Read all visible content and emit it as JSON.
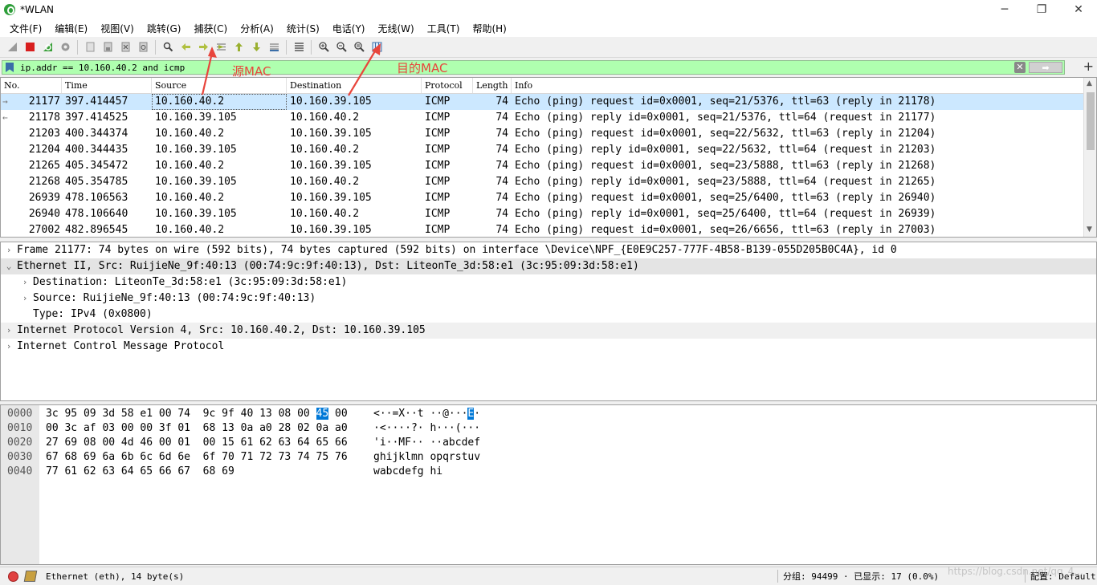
{
  "window": {
    "title": "*WLAN",
    "minimize": "─",
    "maximize": "❐",
    "close": "✕"
  },
  "menu": [
    "文件(F)",
    "编辑(E)",
    "视图(V)",
    "跳转(G)",
    "捕获(C)",
    "分析(A)",
    "统计(S)",
    "电话(Y)",
    "无线(W)",
    "工具(T)",
    "帮助(H)"
  ],
  "filter": {
    "value": "ip.addr == 10.160.40.2 and icmp",
    "clear_icon": "✕",
    "apply_icon": "➡",
    "add_icon": "+"
  },
  "packet_list": {
    "columns": [
      "No.",
      "Time",
      "Source",
      "Destination",
      "Protocol",
      "Length",
      "Info"
    ],
    "rows": [
      {
        "mark": "→",
        "no": "21177",
        "time": "397.414457",
        "src": "10.160.40.2",
        "dst": "10.160.39.105",
        "proto": "ICMP",
        "len": "74",
        "info": "Echo (ping) request  id=0x0001, seq=21/5376, ttl=63 (reply in 21178)"
      },
      {
        "mark": "←",
        "no": "21178",
        "time": "397.414525",
        "src": "10.160.39.105",
        "dst": "10.160.40.2",
        "proto": "ICMP",
        "len": "74",
        "info": "Echo (ping) reply    id=0x0001, seq=21/5376, ttl=64 (request in 21177)"
      },
      {
        "mark": "",
        "no": "21203",
        "time": "400.344374",
        "src": "10.160.40.2",
        "dst": "10.160.39.105",
        "proto": "ICMP",
        "len": "74",
        "info": "Echo (ping) request  id=0x0001, seq=22/5632, ttl=63 (reply in 21204)"
      },
      {
        "mark": "",
        "no": "21204",
        "time": "400.344435",
        "src": "10.160.39.105",
        "dst": "10.160.40.2",
        "proto": "ICMP",
        "len": "74",
        "info": "Echo (ping) reply    id=0x0001, seq=22/5632, ttl=64 (request in 21203)"
      },
      {
        "mark": "",
        "no": "21265",
        "time": "405.345472",
        "src": "10.160.40.2",
        "dst": "10.160.39.105",
        "proto": "ICMP",
        "len": "74",
        "info": "Echo (ping) request  id=0x0001, seq=23/5888, ttl=63 (reply in 21268)"
      },
      {
        "mark": "",
        "no": "21268",
        "time": "405.354785",
        "src": "10.160.39.105",
        "dst": "10.160.40.2",
        "proto": "ICMP",
        "len": "74",
        "info": "Echo (ping) reply    id=0x0001, seq=23/5888, ttl=64 (request in 21265)"
      },
      {
        "mark": "",
        "no": "26939",
        "time": "478.106563",
        "src": "10.160.40.2",
        "dst": "10.160.39.105",
        "proto": "ICMP",
        "len": "74",
        "info": "Echo (ping) request  id=0x0001, seq=25/6400, ttl=63 (reply in 26940)"
      },
      {
        "mark": "",
        "no": "26940",
        "time": "478.106640",
        "src": "10.160.39.105",
        "dst": "10.160.40.2",
        "proto": "ICMP",
        "len": "74",
        "info": "Echo (ping) reply    id=0x0001, seq=25/6400, ttl=64 (request in 26939)"
      },
      {
        "mark": "",
        "no": "27002",
        "time": "482.896545",
        "src": "10.160.40.2",
        "dst": "10.160.39.105",
        "proto": "ICMP",
        "len": "74",
        "info": "Echo (ping) request  id=0x0001, seq=26/6656, ttl=63 (reply in 27003)"
      }
    ]
  },
  "details": [
    {
      "level": 0,
      "arrow": "›",
      "text": "Frame 21177: 74 bytes on wire (592 bits), 74 bytes captured (592 bits) on interface \\Device\\NPF_{E0E9C257-777F-4B58-B139-055D205B0C4A}, id 0"
    },
    {
      "level": 0,
      "arrow": "⌄",
      "text": "Ethernet II, Src: RuijieNe_9f:40:13 (00:74:9c:9f:40:13), Dst: LiteonTe_3d:58:e1 (3c:95:09:3d:58:e1)"
    },
    {
      "level": 1,
      "arrow": "›",
      "text": "Destination: LiteonTe_3d:58:e1 (3c:95:09:3d:58:e1)"
    },
    {
      "level": 1,
      "arrow": "›",
      "text": "Source: RuijieNe_9f:40:13 (00:74:9c:9f:40:13)"
    },
    {
      "level": 1,
      "arrow": "",
      "text": "Type: IPv4 (0x0800)"
    },
    {
      "level": 0,
      "arrow": "›",
      "text": "Internet Protocol Version 4, Src: 10.160.40.2, Dst: 10.160.39.105"
    },
    {
      "level": 0,
      "arrow": "›",
      "text": "Internet Control Message Protocol"
    }
  ],
  "bytes": [
    {
      "offset": "0000",
      "hex_a": "3c 95 09 3d 58 e1 00 74  9c 9f 40 13 08 00 ",
      "hex_hl": "45",
      "hex_b": " 00",
      "ascii_a": "<··=X··t ··@···",
      "ascii_hl": "E",
      "ascii_b": "·"
    },
    {
      "offset": "0010",
      "hex_a": "00 3c af 03 00 00 3f 01  68 13 0a a0 28 02 0a a0",
      "hex_hl": "",
      "hex_b": "",
      "ascii_a": "·<····?· h···(···",
      "ascii_hl": "",
      "ascii_b": ""
    },
    {
      "offset": "0020",
      "hex_a": "27 69 08 00 4d 46 00 01  00 15 61 62 63 64 65 66",
      "hex_hl": "",
      "hex_b": "",
      "ascii_a": "'i··MF·· ··abcdef",
      "ascii_hl": "",
      "ascii_b": ""
    },
    {
      "offset": "0030",
      "hex_a": "67 68 69 6a 6b 6c 6d 6e  6f 70 71 72 73 74 75 76",
      "hex_hl": "",
      "hex_b": "",
      "ascii_a": "ghijklmn opqrstuv",
      "ascii_hl": "",
      "ascii_b": ""
    },
    {
      "offset": "0040",
      "hex_a": "77 61 62 63 64 65 66 67  68 69",
      "hex_hl": "",
      "hex_b": "",
      "ascii_a": "wabcdefg hi",
      "ascii_hl": "",
      "ascii_b": ""
    }
  ],
  "status": {
    "left": "Ethernet (eth), 14 byte(s)",
    "mid": "分组: 94499 · 已显示: 17 (0.0%)",
    "right": "配置: Default",
    "watermark": "https://blog.csdn.net/qq_4..."
  },
  "annotations": {
    "src_mac": "源MAC",
    "dst_mac": "目的MAC",
    "color": "#e8453c"
  },
  "colors": {
    "filter_bg": "#afffaf",
    "selected_row": "#cce8ff",
    "byte_highlight": "#0078d7"
  }
}
